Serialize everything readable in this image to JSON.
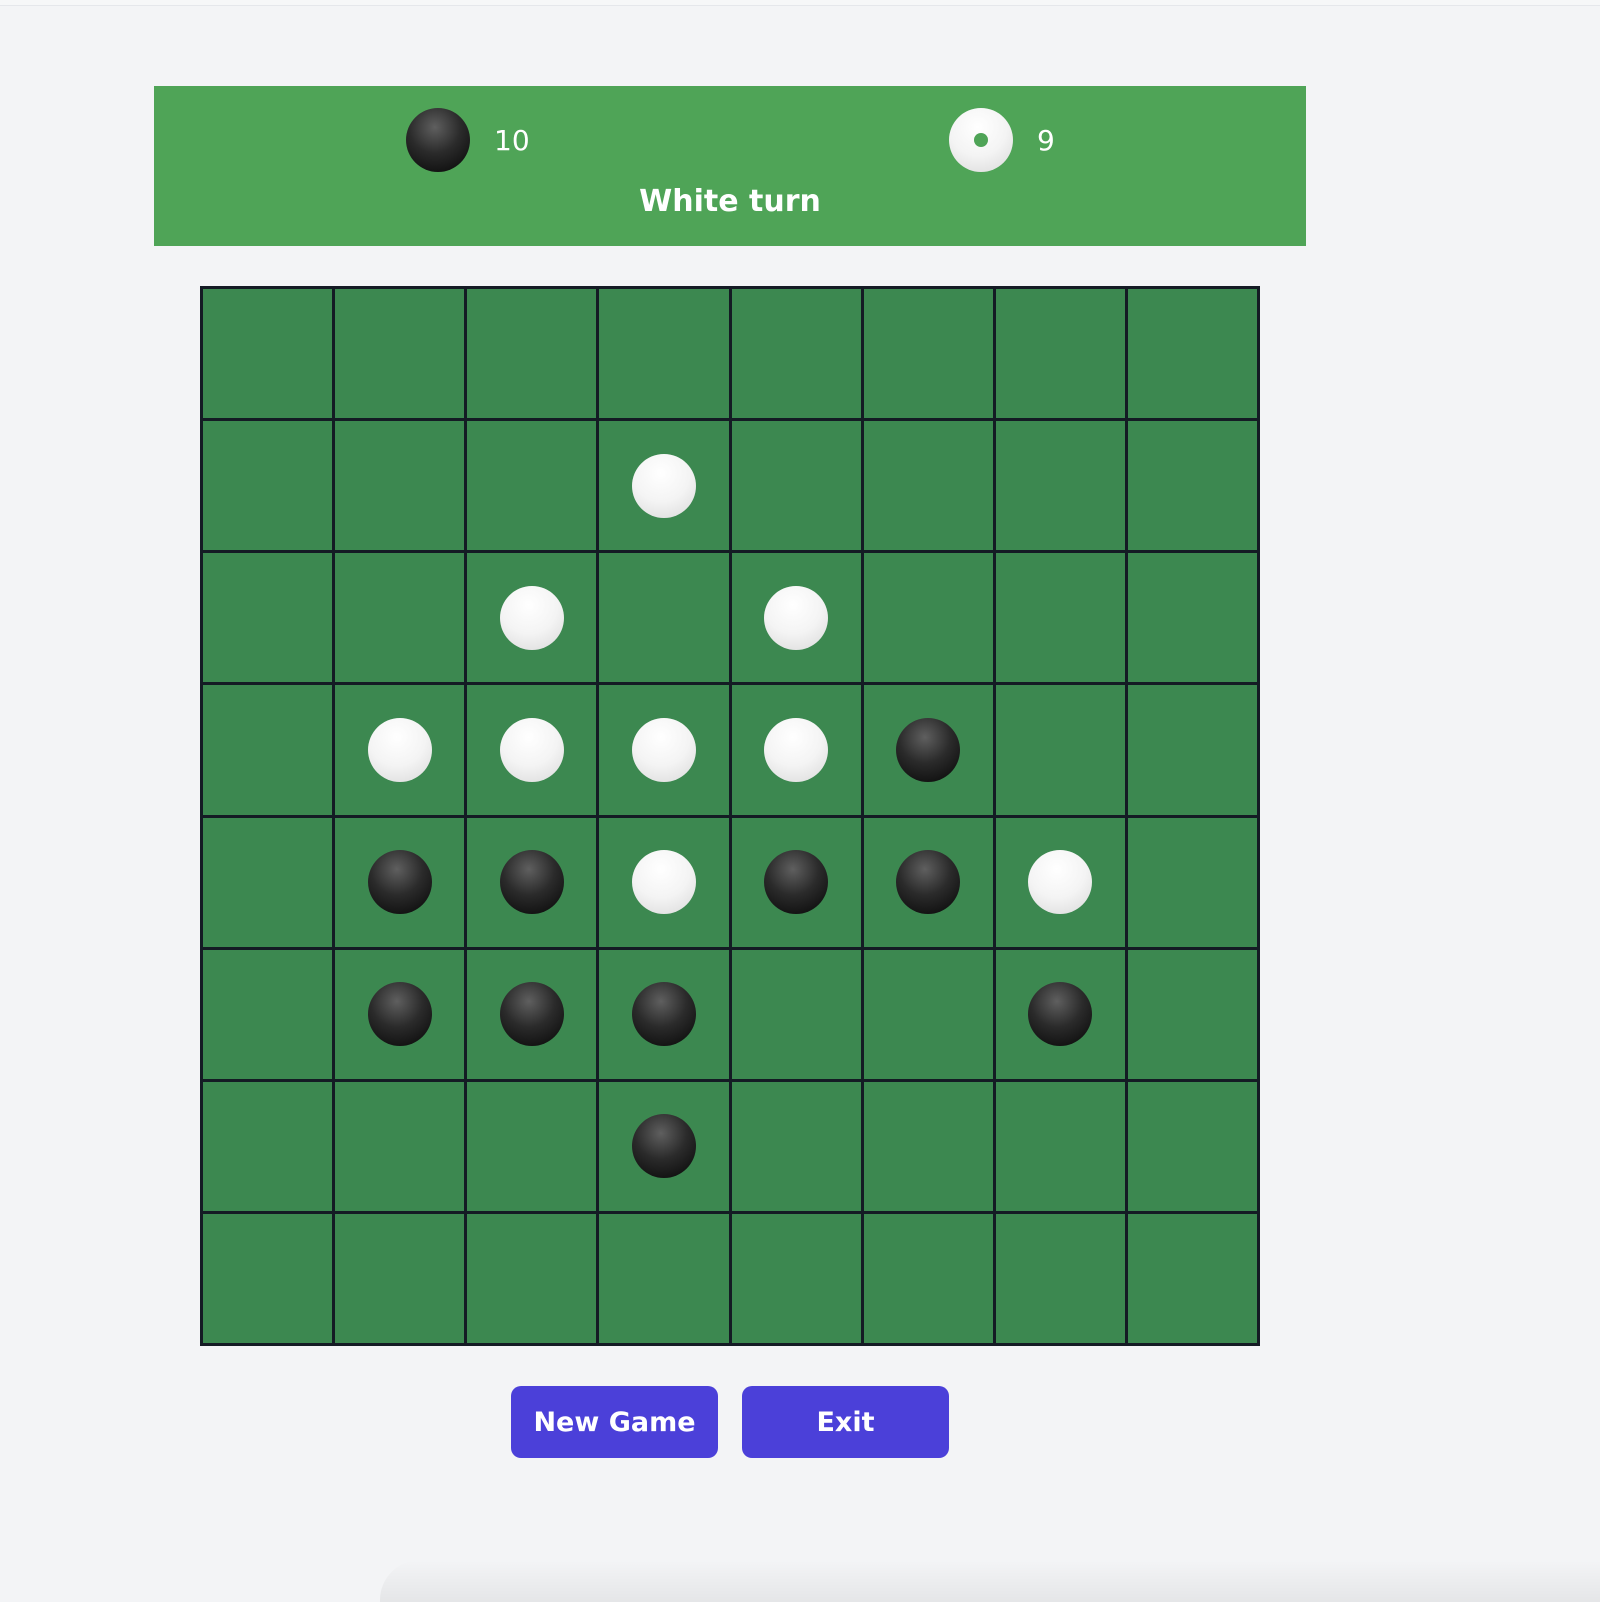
{
  "score": {
    "black": {
      "icon": "black-disc-icon",
      "count": "10"
    },
    "white": {
      "icon": "white-disc-icon",
      "count": "9"
    },
    "turn_label": "White turn",
    "current_turn": "white"
  },
  "board": {
    "size": 8,
    "rows": [
      [
        "",
        "",
        "",
        "",
        "",
        "",
        "",
        ""
      ],
      [
        "",
        "",
        "",
        "W",
        "",
        "",
        "",
        ""
      ],
      [
        "",
        "",
        "W",
        "",
        "W",
        "",
        "",
        ""
      ],
      [
        "",
        "W",
        "W",
        "W",
        "W",
        "B",
        "",
        ""
      ],
      [
        "",
        "B",
        "B",
        "W",
        "B",
        "B",
        "W",
        ""
      ],
      [
        "",
        "B",
        "B",
        "B",
        "",
        "",
        "B",
        ""
      ],
      [
        "",
        "",
        "",
        "B",
        "",
        "",
        "",
        ""
      ],
      [
        "",
        "",
        "",
        "",
        "",
        "",
        "",
        ""
      ]
    ]
  },
  "buttons": {
    "new_game": "New Game",
    "exit": "Exit"
  },
  "colors": {
    "score_bar": "#4fa457",
    "board_cell": "#3c8850",
    "grid_line": "#141b24",
    "button": "#4b40d9",
    "background": "#f3f4f6"
  }
}
